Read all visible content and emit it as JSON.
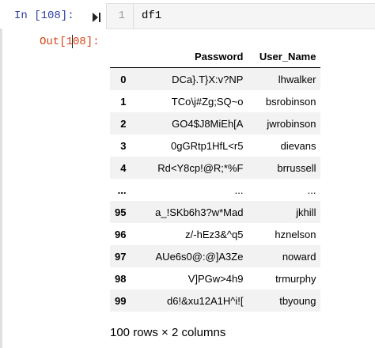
{
  "input_cell": {
    "prompt": "In [108]:",
    "line_number": "1",
    "code": "df1"
  },
  "output_cell": {
    "prompt": "Out[108]:"
  },
  "table": {
    "columns": [
      "Password",
      "User_Name"
    ],
    "rows": [
      {
        "index": "0",
        "password": "DCa}.T}X:v?NP",
        "user": "lhwalker"
      },
      {
        "index": "1",
        "password": "TCo\\j#Zg;SQ~o",
        "user": "bsrobinson"
      },
      {
        "index": "2",
        "password": "GO4$J8MiEh[A",
        "user": "jwrobinson"
      },
      {
        "index": "3",
        "password": "0gGRtp1HfL<r5",
        "user": "dievans"
      },
      {
        "index": "4",
        "password": "Rd<Y8cp!@R;*%F",
        "user": "brrussell"
      },
      {
        "index": "...",
        "password": "...",
        "user": "..."
      },
      {
        "index": "95",
        "password": "a_!SKb6h3?w*Mad",
        "user": "jkhill"
      },
      {
        "index": "96",
        "password": "z/-hEz3&^q5",
        "user": "hznelson"
      },
      {
        "index": "97",
        "password": "AUe6s0@:@]A3Ze",
        "user": "noward"
      },
      {
        "index": "98",
        "password": "V]PGw>4h9",
        "user": "trmurphy"
      },
      {
        "index": "99",
        "password": "d6!&xu12A1H^i![",
        "user": "tbyoung"
      }
    ]
  },
  "shape_text": "100 rows × 2 columns"
}
